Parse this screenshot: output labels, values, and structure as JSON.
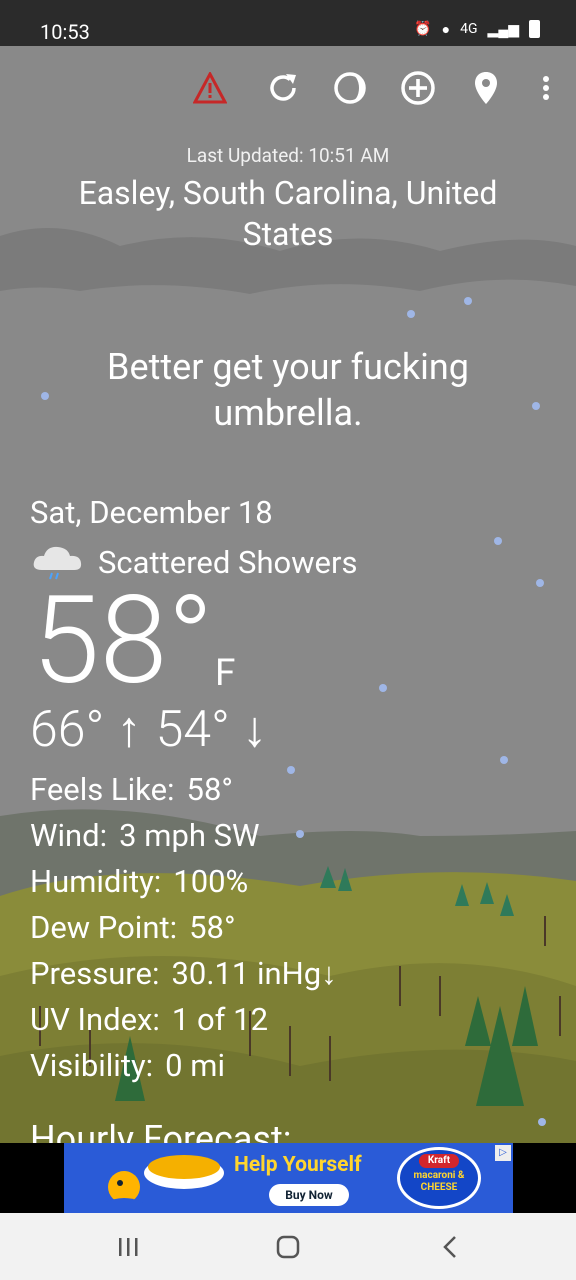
{
  "status_bar": {
    "time": "10:53",
    "network": "4G"
  },
  "toolbar": {
    "icons": [
      "alert-icon",
      "refresh-icon",
      "theme-icon",
      "add-location-icon",
      "location-pin-icon",
      "more-vert-icon"
    ],
    "alert_color": "#c62828"
  },
  "header": {
    "last_updated": "Last Updated: 10:51 AM",
    "location": "Easley, South Carolina, United States"
  },
  "quip": "Better get your fucking umbrella.",
  "current": {
    "date": "Sat, December 18",
    "condition": "Scattered Showers",
    "condition_icon": "cloud-rain-icon",
    "temperature": "58°",
    "unit": "F",
    "high": "66° ↑",
    "low": "54° ↓"
  },
  "details": [
    {
      "label": "Feels Like:",
      "value": "58°"
    },
    {
      "label": "Wind:",
      "value": "3 mph SW"
    },
    {
      "label": "Humidity:",
      "value": "100%"
    },
    {
      "label": "Dew Point:",
      "value": "58°"
    },
    {
      "label": "Pressure:",
      "value": "30.11 inHg↓"
    },
    {
      "label": "UV Index:",
      "value": "1 of 12"
    },
    {
      "label": "Visibility:",
      "value": "0 mi"
    }
  ],
  "hourly_title": "Hourly Forecast:",
  "ad": {
    "headline": "Help Yourself",
    "cta": "Buy Now",
    "brand": "Kraft",
    "product": "macaroni & CHEESE"
  },
  "navbar": {
    "buttons": [
      "recents-button",
      "home-button",
      "back-button"
    ]
  }
}
